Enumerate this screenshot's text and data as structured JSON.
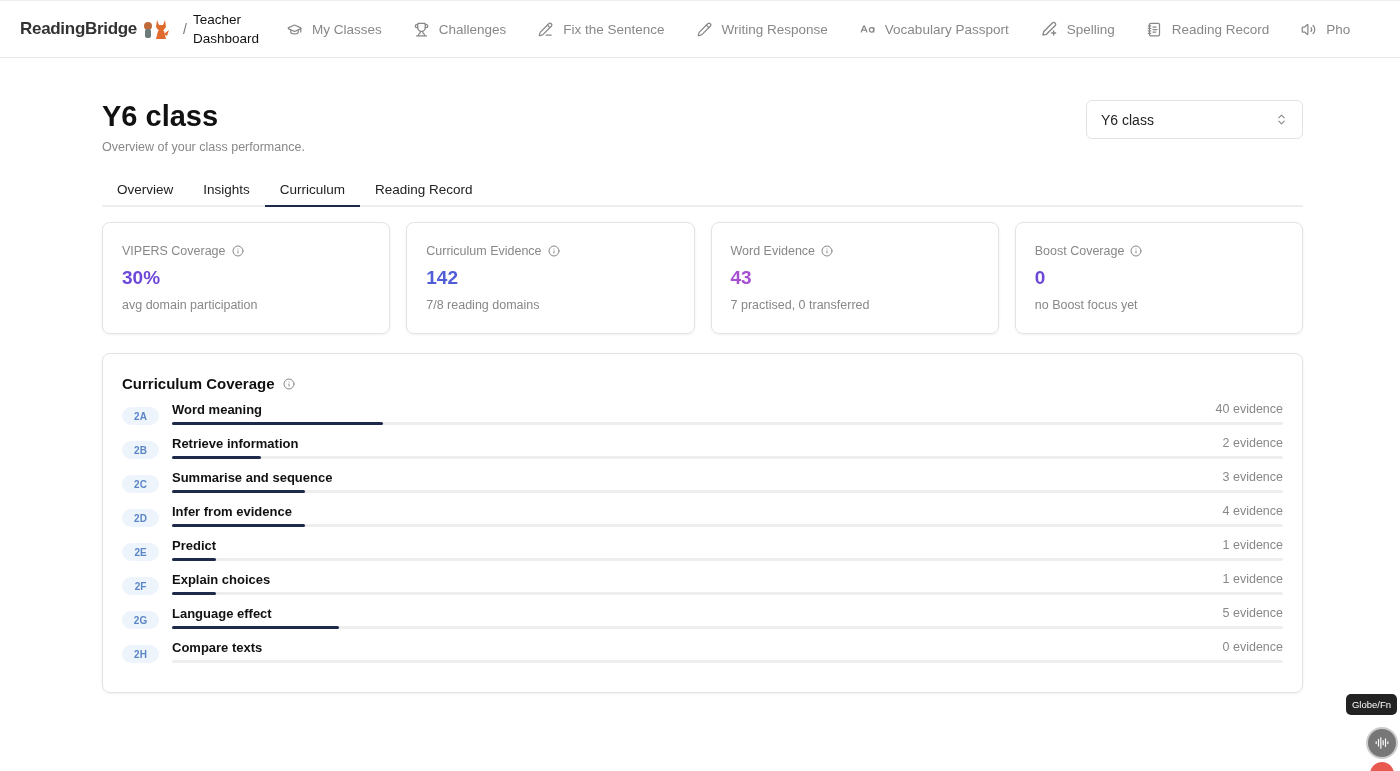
{
  "brand": {
    "name": "ReadingBridge",
    "separator": "/",
    "section": "Teacher Dashboard"
  },
  "nav": [
    {
      "label": "My Classes",
      "kind": "cap"
    },
    {
      "label": "Challenges",
      "kind": "trophy"
    },
    {
      "label": "Fix the Sentence",
      "kind": "pencil-line"
    },
    {
      "label": "Writing Response",
      "kind": "pencil"
    },
    {
      "label": "Vocabulary Passport",
      "kind": "abc"
    },
    {
      "label": "Spelling",
      "kind": "pencil-plus"
    },
    {
      "label": "Reading Record",
      "kind": "notebook"
    },
    {
      "label": "Pho",
      "kind": "speaker"
    }
  ],
  "page": {
    "title": "Y6 class",
    "subtitle": "Overview of your class performance.",
    "class_select": {
      "value": "Y6 class"
    }
  },
  "tabs": [
    {
      "label": "Overview",
      "selected": false
    },
    {
      "label": "Insights",
      "selected": false
    },
    {
      "label": "Curriculum",
      "selected": true
    },
    {
      "label": "Reading Record",
      "selected": false
    }
  ],
  "stats": [
    {
      "label": "VIPERS Coverage",
      "value": "30%",
      "note": "avg domain participation",
      "color": "#6d48d8"
    },
    {
      "label": "Curriculum Evidence",
      "value": "142",
      "note": "7/8 reading domains",
      "color": "#4f5ed6"
    },
    {
      "label": "Word Evidence",
      "value": "43",
      "note": "7 practised, 0 transferred",
      "color": "#a64fd0"
    },
    {
      "label": "Boost Coverage",
      "value": "0",
      "note": "no Boost focus yet",
      "color": "#6d48d8"
    }
  ],
  "coverage": {
    "title": "Curriculum Coverage",
    "rows": [
      {
        "code": "2A",
        "name": "Word meaning",
        "evidence": "40 evidence",
        "level": 0.19
      },
      {
        "code": "2B",
        "name": "Retrieve information",
        "evidence": "2 evidence",
        "level": 0.08
      },
      {
        "code": "2C",
        "name": "Summarise and sequence",
        "evidence": "3 evidence",
        "level": 0.12
      },
      {
        "code": "2D",
        "name": "Infer from evidence",
        "evidence": "4 evidence",
        "level": 0.12
      },
      {
        "code": "2E",
        "name": "Predict",
        "evidence": "1 evidence",
        "level": 0.04
      },
      {
        "code": "2F",
        "name": "Explain choices",
        "evidence": "1 evidence",
        "level": 0.04
      },
      {
        "code": "2G",
        "name": "Language effect",
        "evidence": "5 evidence",
        "level": 0.15
      },
      {
        "code": "2H",
        "name": "Compare texts",
        "evidence": "0 evidence",
        "level": 0
      }
    ]
  },
  "tooltip": "Globe/Fn"
}
